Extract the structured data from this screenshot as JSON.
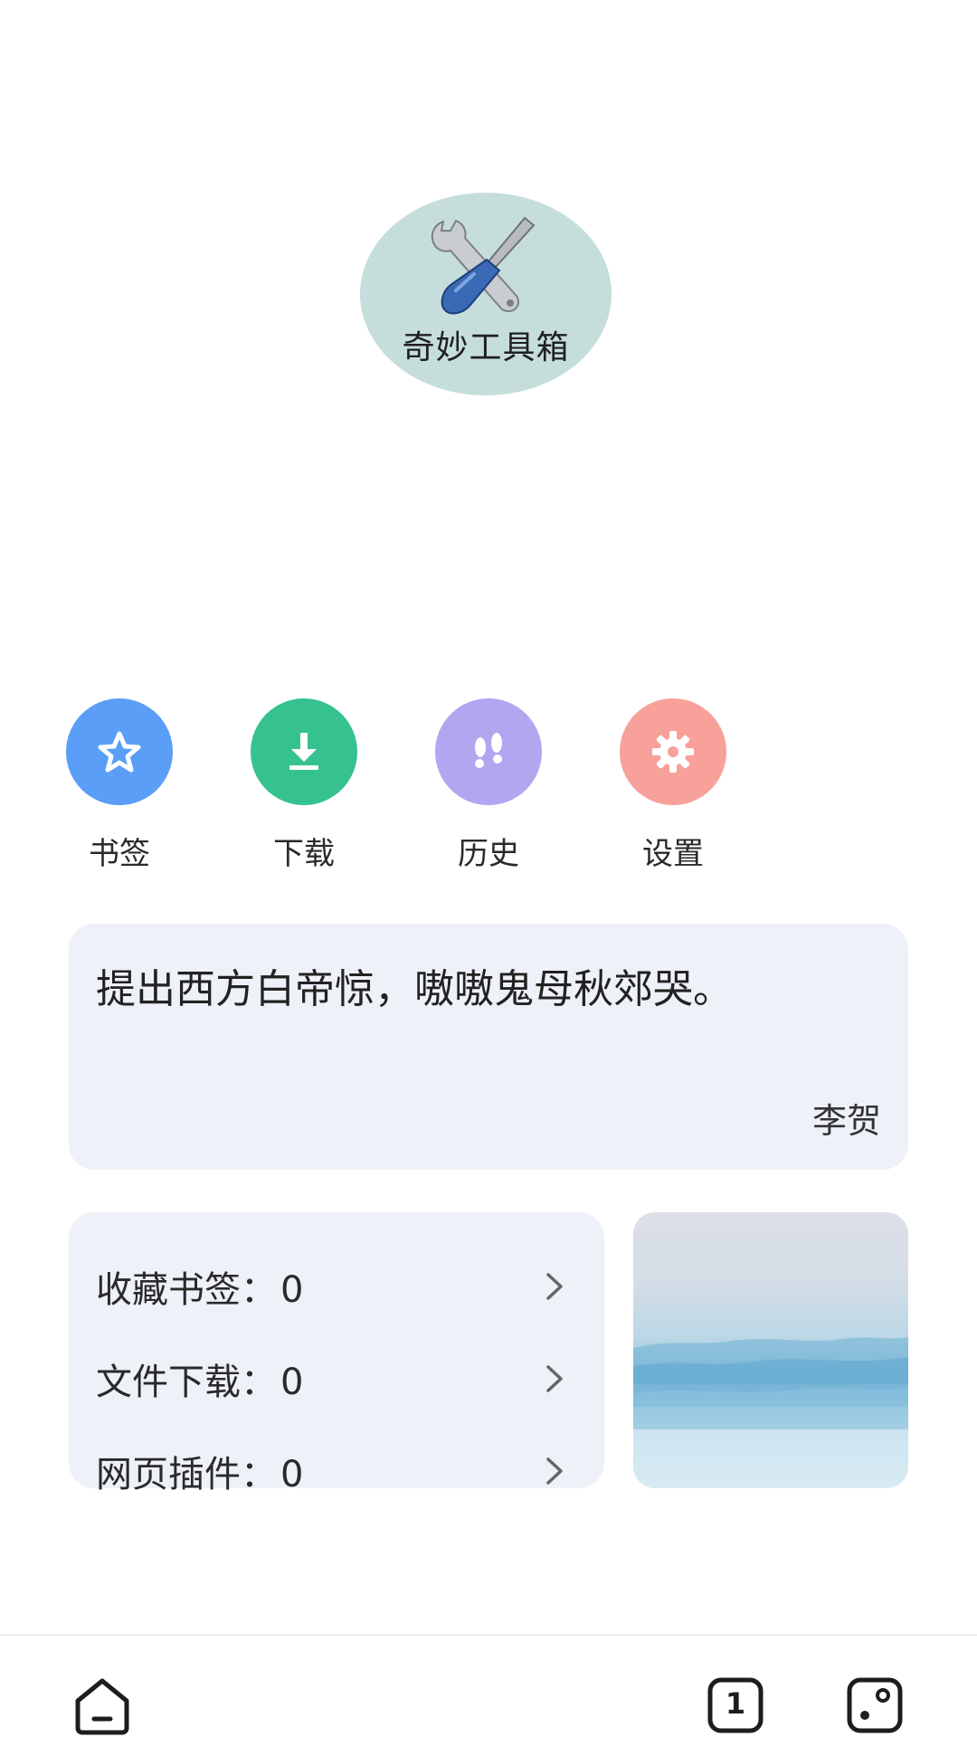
{
  "logo": {
    "title": "奇妙工具箱"
  },
  "quick_actions": [
    {
      "label": "书签",
      "icon": "star-icon",
      "color": "#5b9ef7"
    },
    {
      "label": "下载",
      "icon": "download-icon",
      "color": "#35c28f"
    },
    {
      "label": "历史",
      "icon": "footprints-icon",
      "color": "#b2a6f1"
    },
    {
      "label": "设置",
      "icon": "gear-icon",
      "color": "#f8a09a"
    }
  ],
  "quote": {
    "text": "提出西方白帝惊，嗷嗷鬼母秋郊哭。",
    "author": "李贺"
  },
  "stats": [
    {
      "label": "收藏书签：",
      "value": "0"
    },
    {
      "label": "文件下载：",
      "value": "0"
    },
    {
      "label": "网页插件：",
      "value": "0"
    }
  ],
  "bottom_nav": {
    "home_icon": "home-icon",
    "tab_count": "1",
    "dice_icon": "dice-icon"
  }
}
